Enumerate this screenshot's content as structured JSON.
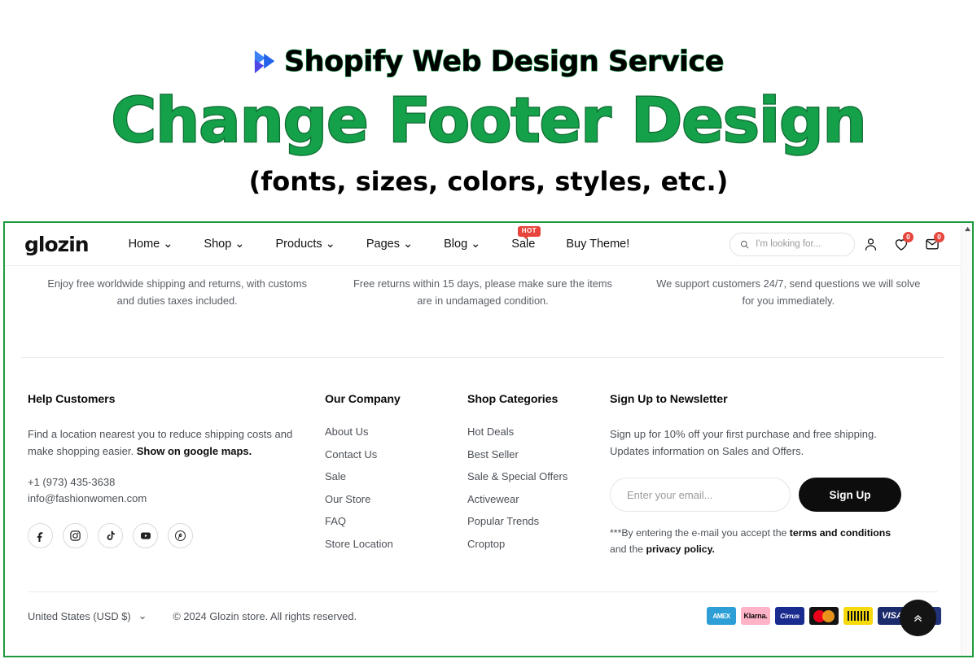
{
  "promo": {
    "arrow_icon": "double-chevron-right-icon",
    "title_line1": "Shopify Web Design Service",
    "title_line2": "Change Footer Design",
    "title_line3": "(fonts, sizes, colors, styles, etc.)",
    "green": "#15a04a",
    "black": "#000000"
  },
  "header": {
    "logo": "glozin",
    "nav": [
      {
        "label": "Home",
        "caret": "⌄",
        "badge": null
      },
      {
        "label": "Shop",
        "caret": "⌄",
        "badge": null
      },
      {
        "label": "Products",
        "caret": "⌄",
        "badge": null
      },
      {
        "label": "Pages",
        "caret": "⌄",
        "badge": null
      },
      {
        "label": "Blog",
        "caret": "⌄",
        "badge": null
      },
      {
        "label": "Sale",
        "caret": "",
        "badge": "HOT"
      },
      {
        "label": "Buy Theme!",
        "caret": "",
        "badge": null
      }
    ],
    "search": {
      "placeholder": "I'm looking for...",
      "value": "",
      "icon": "search-icon"
    },
    "account_icon": "user-icon",
    "wishlist": {
      "icon": "heart-icon",
      "count": "0"
    },
    "cart": {
      "icon": "cart-icon",
      "count": "0"
    },
    "badge_color": "#e7453c"
  },
  "info_strip": {
    "columns": [
      "Enjoy free worldwide shipping and returns, with customs and duties taxes included.",
      "Free returns within 15 days, please make sure the items are in undamaged condition.",
      "We support customers 24/7, send questions we will solve for you immediately."
    ]
  },
  "footer": {
    "help": {
      "title": "Help Customers",
      "text_part1": "Find a location nearest you to reduce shipping costs and make shopping easier. ",
      "text_bold": "Show on google maps.",
      "phone": "+1 (973) 435-3638",
      "email": "info@fashionwomen.com",
      "socials": [
        {
          "name": "facebook-icon",
          "glyph": "f"
        },
        {
          "name": "instagram-icon",
          "glyph": ""
        },
        {
          "name": "tiktok-icon",
          "glyph": ""
        },
        {
          "name": "youtube-icon",
          "glyph": ""
        },
        {
          "name": "pinterest-icon",
          "glyph": "P"
        }
      ]
    },
    "company": {
      "title": "Our Company",
      "links": [
        "About Us",
        "Contact Us",
        "Sale",
        "Our Store",
        "FAQ",
        "Store Location"
      ]
    },
    "categories": {
      "title": "Shop Categories",
      "links": [
        "Hot Deals",
        "Best Seller",
        "Sale & Special Offers",
        "Activewear",
        "Popular Trends",
        "Croptop"
      ]
    },
    "newsletter": {
      "title": "Sign Up to Newsletter",
      "text": "Sign up for 10% off your first purchase and free shipping. Updates information on Sales and Offers.",
      "input_placeholder": "Enter your email...",
      "input_value": "",
      "button_label": "Sign Up",
      "disclaimer_part1": "***By entering the e-mail you accept the ",
      "disclaimer_bold1": "terms and conditions",
      "disclaimer_part2": " and the ",
      "disclaimer_bold2": "privacy policy."
    },
    "bottom": {
      "country": "United States (USD $)",
      "country_caret": "⌄",
      "copyright": "© 2024 Glozin store. All rights reserved.",
      "payments": [
        {
          "name": "amex-badge",
          "label": "AMEX"
        },
        {
          "name": "klarna-badge",
          "label": "Klarna."
        },
        {
          "name": "cirrus-badge",
          "label": "Cirrus"
        },
        {
          "name": "mastercard-badge",
          "label": ""
        },
        {
          "name": "maestro-badge",
          "label": ""
        },
        {
          "name": "visa-badge",
          "label": "VISA"
        },
        {
          "name": "paypal-badge",
          "label": "Pay"
        }
      ],
      "scroll_top_icon": "chevron-double-up-icon"
    }
  },
  "scrollbar": {
    "arrow_up_icon": "scroll-up-arrow-icon"
  },
  "frame_color": "#1f9a3d"
}
